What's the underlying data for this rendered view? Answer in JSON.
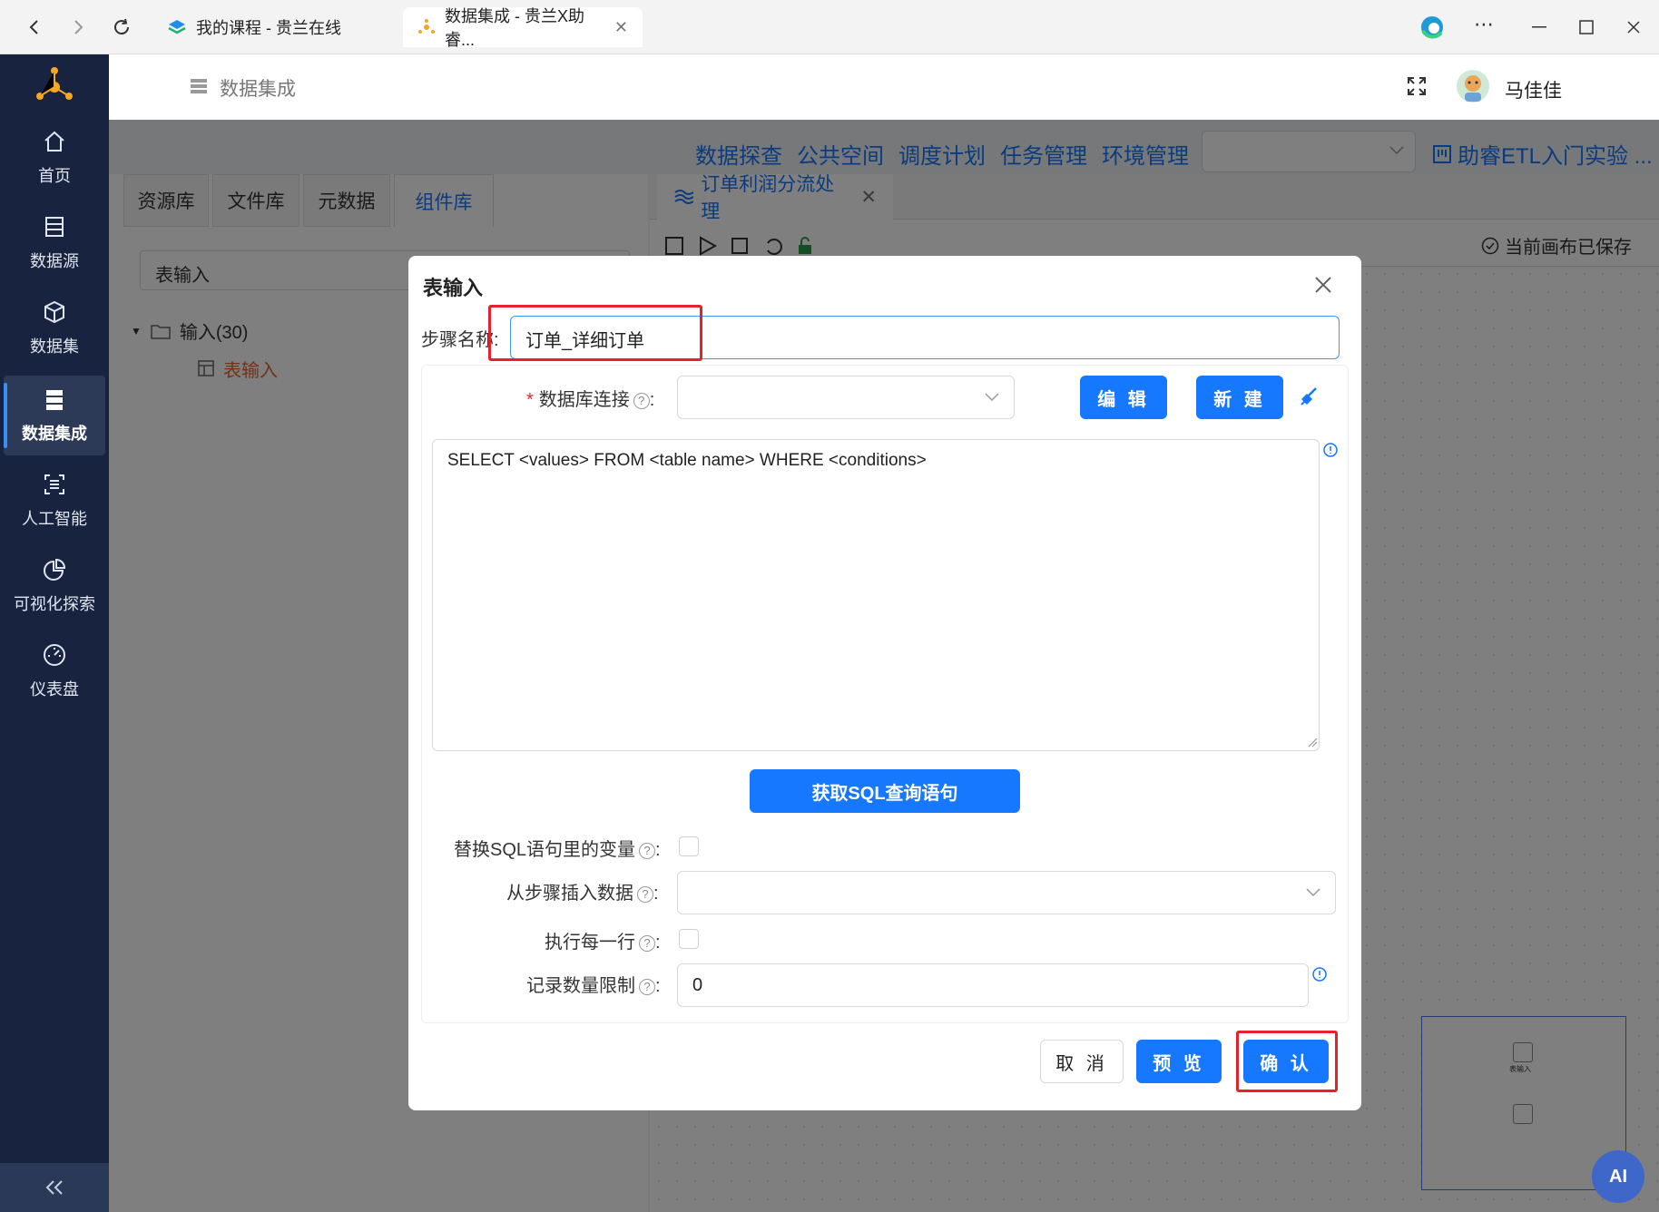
{
  "browser": {
    "tabs": [
      {
        "title": "我的课程 - 贵兰在线"
      },
      {
        "title": "数据集成 - 贵兰X助睿..."
      }
    ]
  },
  "sidebar": {
    "items": [
      {
        "label": "首页",
        "icon": "home-icon"
      },
      {
        "label": "数据源",
        "icon": "database-icon"
      },
      {
        "label": "数据集",
        "icon": "cube-icon"
      },
      {
        "label": "数据集成",
        "icon": "server-icon"
      },
      {
        "label": "人工智能",
        "icon": "ai-scan-icon"
      },
      {
        "label": "可视化探索",
        "icon": "pie-chart-icon"
      },
      {
        "label": "仪表盘",
        "icon": "dashboard-icon"
      }
    ]
  },
  "header": {
    "breadcrumb": "数据集成",
    "user_name": "马佳佳"
  },
  "topnav": {
    "links": [
      "数据探查",
      "公共空间",
      "调度计划",
      "任务管理",
      "环境管理"
    ],
    "project": "助睿ETL入门实验 ..."
  },
  "leftpanel": {
    "tabs": [
      "资源库",
      "文件库",
      "元数据",
      "组件库"
    ],
    "search_value": "表输入",
    "tree_folder": "输入(30)",
    "tree_item": "表输入"
  },
  "canvas": {
    "tab_title": "订单利润分流处理",
    "save_status": "当前画布已保存",
    "minimap_node_label": "表输入",
    "ai_label": "AI"
  },
  "dialog": {
    "title": "表输入",
    "step_name_label": "步骤名称",
    "step_name_value": "订单_详细订单",
    "db_conn_label": "数据库连接",
    "edit_label": "编 辑",
    "new_label": "新 建",
    "sql_text": "SELECT <values> FROM <table name> WHERE <conditions>",
    "get_sql_label": "获取SQL查询语句",
    "replace_var_label": "替换SQL语句里的变量",
    "insert_from_step_label": "从步骤插入数据",
    "exec_each_row_label": "执行每一行",
    "limit_label": "记录数量限制",
    "limit_value": "0",
    "cancel_label": "取 消",
    "preview_label": "预 览",
    "confirm_label": "确 认"
  }
}
